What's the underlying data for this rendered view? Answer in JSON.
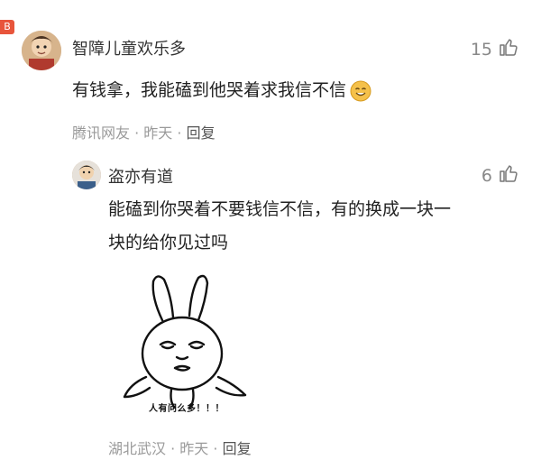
{
  "corner_badge": "B",
  "comment": {
    "username": "智障儿童欢乐多",
    "likes": "15",
    "text": "有钱拿，我能磕到他哭着求我信不信",
    "location": "腾讯网友",
    "time": "昨天",
    "separator": "·",
    "reply_label": "回复"
  },
  "reply": {
    "username": "盗亦有道",
    "likes": "6",
    "text_line1": "能磕到你哭着不要钱信不信，有的换成一块一",
    "text_line2": "块的给你见过吗",
    "meme_caption": "人有问么多！！！",
    "location": "湖北武汉",
    "time": "昨天",
    "separator": "·",
    "reply_label": "回复"
  },
  "icons": {
    "like": "thumbs-up-icon",
    "emoji": "smile-emoji-icon"
  },
  "colors": {
    "badge": "#e8553b",
    "meta_text": "#9a9a9a",
    "username": "#333333",
    "emoji": "#f5c14a"
  }
}
